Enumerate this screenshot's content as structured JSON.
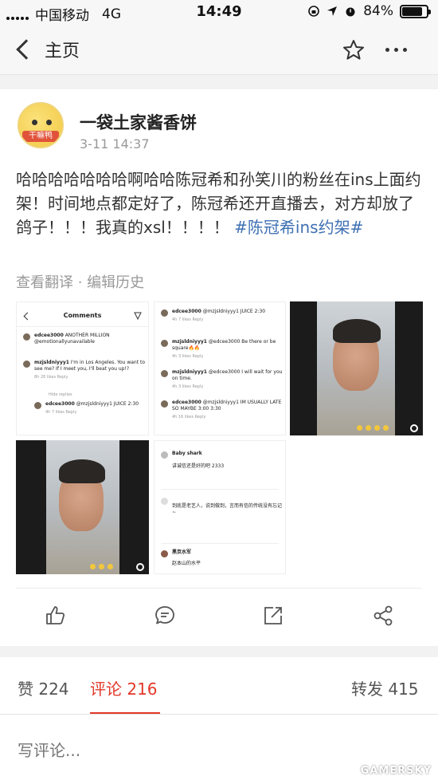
{
  "status_bar": {
    "carrier": "中国移动",
    "network": "4G",
    "time": "14:49",
    "battery": "84%",
    "battery_level": 0.84
  },
  "nav": {
    "back_label": "主页",
    "icons": [
      "back-chevron-icon",
      "star-icon",
      "more-icon"
    ]
  },
  "post": {
    "username": "一袋土家酱香饼",
    "avatar_tag": "干嘛鸭",
    "time": "3-11 14:37",
    "text": "哈哈哈哈哈哈哈啊哈哈陈冠希和孙笑川的粉丝在ins上面约架！时间地点都定好了，陈冠希还开直播去，对方却放了鸽子！！！我真的xsl！！！！",
    "topic": "#陈冠希ins约架#",
    "translate": "查看翻译",
    "separator": " · ",
    "edit_history": "编辑历史"
  },
  "photos": {
    "p1": {
      "header": "Comments",
      "comments": [
        {
          "user": "edcee3000",
          "text": "ANOTHER MILLION @emotionallyunavailable"
        },
        {
          "user": "mzjsldniyyy1",
          "text": "I'm in Los Angeles. You want to see me? If I meet you, I'll beat you up!?",
          "meta": "8h   26 likes   Reply"
        },
        {
          "user": "",
          "text": "Hide replies"
        },
        {
          "user": "edcee3000",
          "text": "@mzjsldniyyy1 JUICE 2:30",
          "meta": "4h   7 likes   Reply"
        }
      ]
    },
    "p2": {
      "comments": [
        {
          "user": "edcee3000",
          "text": "@mzjsldniyyy1 JUICE 2:30",
          "meta": "4h   7 likes   Reply"
        },
        {
          "user": "mzjsldniyyy1",
          "text": "@edcee3000 Be there or be square🔥🔥",
          "meta": "4h   3 likes   Reply"
        },
        {
          "user": "mzjsldniyyy1",
          "text": "@edcee3000 I will wait for you on time.",
          "meta": "4h   3 likes   Reply"
        },
        {
          "user": "edcee3000",
          "text": "@mzjsldniyyy1 IM USUALLY LATE SO MAYBE 3:00 3:30",
          "meta": "4h   16 likes   Reply"
        }
      ]
    },
    "p5": {
      "comments": [
        {
          "user": "Baby shark",
          "text": "讲诚信还是好的吧 2333"
        },
        {
          "user": "",
          "text": "到底是老艺人，说到做到，言而有信的传统没有忘记~"
        },
        {
          "user": "黑京水军",
          "text": "赵本山的水平"
        }
      ]
    }
  },
  "tabs": {
    "likes": "赞 224",
    "comments": "评论 216",
    "reposts": "转发 415"
  },
  "comment_placeholder": "写评论...",
  "watermark": "GAMERSKY",
  "colors": {
    "accent": "#e2382a",
    "topic_link": "#3f70b3"
  }
}
